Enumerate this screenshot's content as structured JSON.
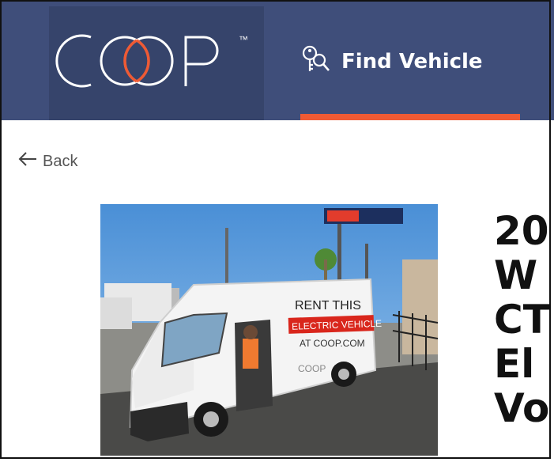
{
  "brand": {
    "name": "COOP",
    "trademark": "™"
  },
  "nav": {
    "find_vehicle": "Find Vehicle"
  },
  "back": {
    "label": "Back"
  },
  "photo": {
    "sign_text": "RENT THIS",
    "banner_text": "ELECTRIC VEHICLE",
    "url_text": "AT COOP.COM",
    "van_logo": "COOP"
  },
  "title_lines": [
    "20",
    "W",
    "CT",
    "El",
    "Vo"
  ],
  "colors": {
    "nav_bg": "#3f4e7a",
    "logo_bg": "#36446b",
    "accent": "#ef5a34"
  }
}
